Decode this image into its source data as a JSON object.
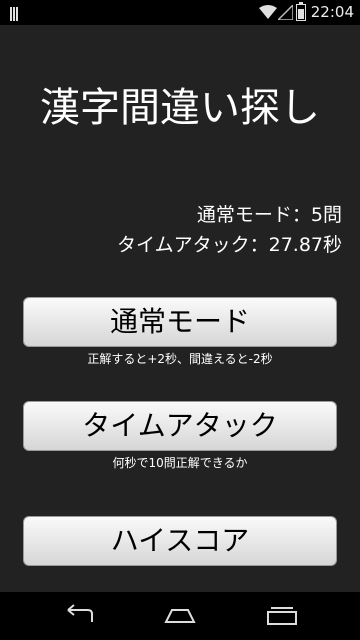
{
  "status_bar": {
    "time": "22:04",
    "icons": [
      "notification-icon",
      "wifi-icon",
      "cellular-icon",
      "battery-charging-icon"
    ]
  },
  "app": {
    "title": "漢字間違い探し",
    "stats": {
      "normal_mode": "通常モード：5問",
      "time_attack": "タイムアタック：27.87秒"
    },
    "buttons": {
      "normal_mode": "通常モード",
      "time_attack": "タイムアタック",
      "high_score": "ハイスコア"
    },
    "descriptions": {
      "normal_mode": "正解すると+2秒、間違えると-2秒",
      "time_attack": "何秒で10問正解できるか"
    }
  },
  "nav_bar": {
    "icons": [
      "back-icon",
      "home-icon",
      "recent-apps-icon"
    ]
  }
}
